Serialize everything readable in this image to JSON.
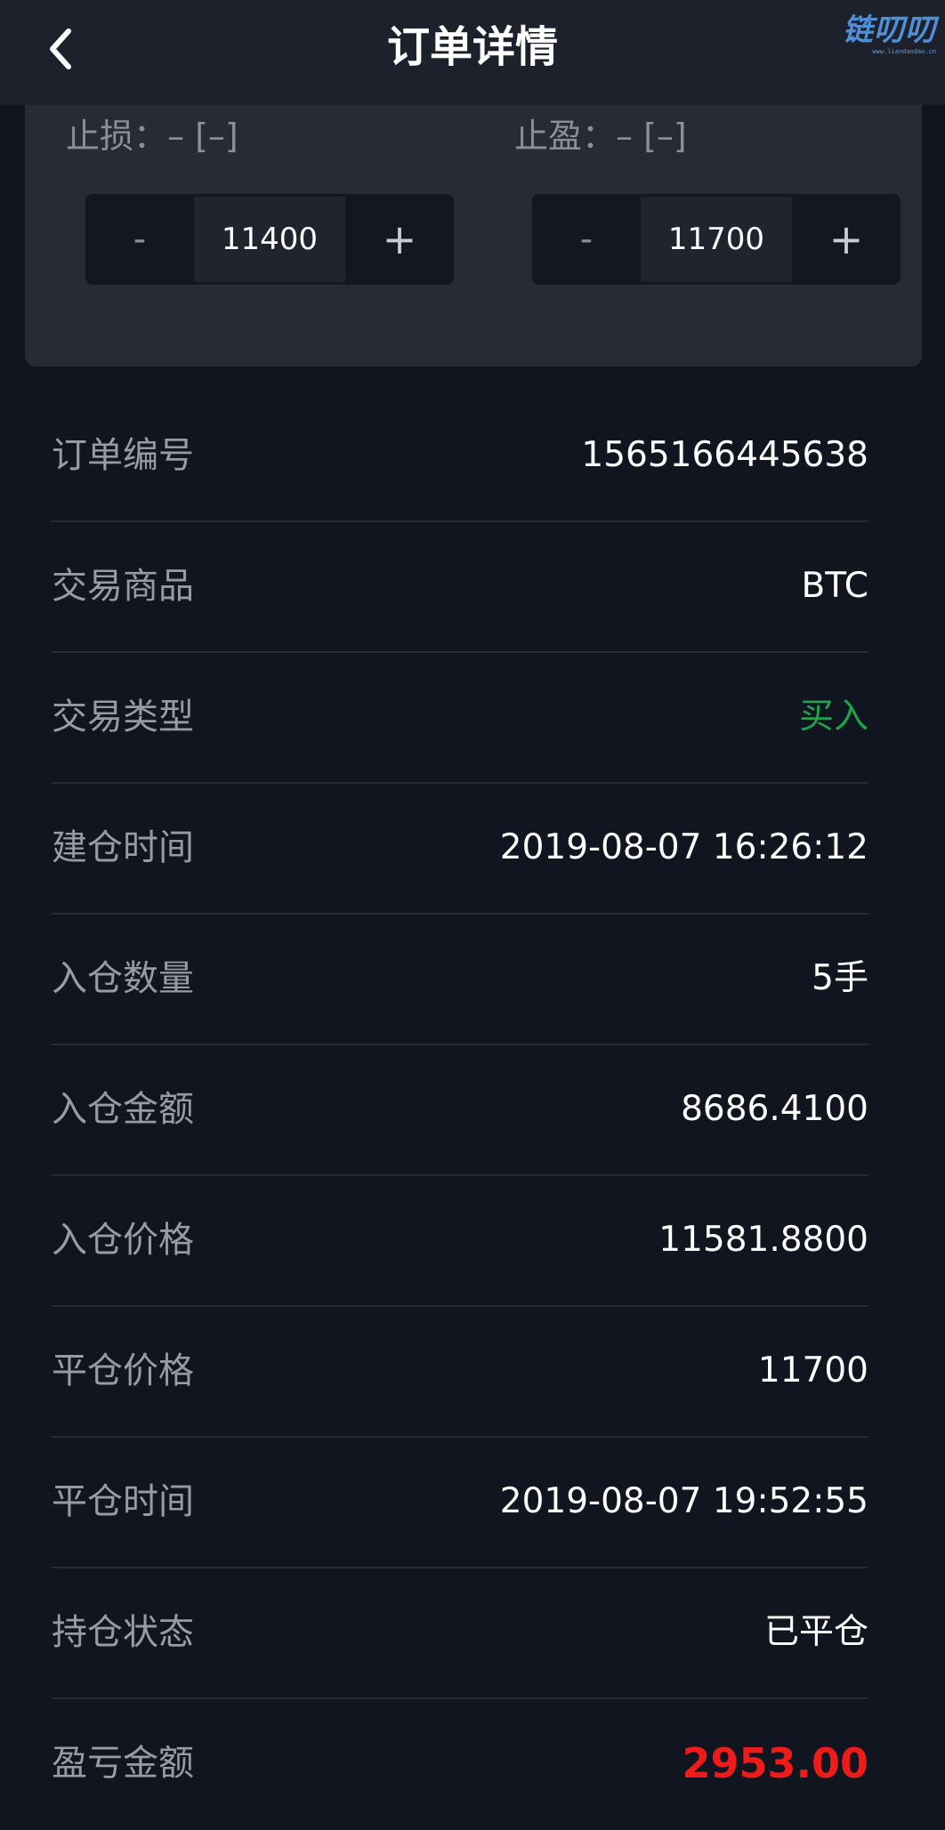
{
  "header": {
    "title": "订单详情",
    "back_icon": "chevron-left-icon",
    "watermark": "链叨叨",
    "watermark_sub": "www.liandaodao.cn"
  },
  "stop_loss": {
    "label": "止损：– [–]",
    "minus": "-",
    "value": "11400",
    "plus": "+"
  },
  "take_profit": {
    "label": "止盈：– [–]",
    "minus": "-",
    "value": "11700",
    "plus": "+"
  },
  "details": [
    {
      "label": "订单编号",
      "value": "1565166445638"
    },
    {
      "label": "交易商品",
      "value": "BTC"
    },
    {
      "label": "交易类型",
      "value": "买入"
    },
    {
      "label": "建仓时间",
      "value": "2019-08-07 16:26:12"
    },
    {
      "label": "入仓数量",
      "value": "5手"
    },
    {
      "label": "入仓金额",
      "value": "8686.4100"
    },
    {
      "label": "入仓价格",
      "value": "11581.8800"
    },
    {
      "label": "平仓价格",
      "value": "11700"
    },
    {
      "label": "平仓时间",
      "value": "2019-08-07 19:52:55"
    },
    {
      "label": "持仓状态",
      "value": "已平仓"
    },
    {
      "label": "盈亏金额",
      "value": "2953.00"
    }
  ],
  "colors": {
    "background": "#11151f",
    "buy_green": "#1fa34a",
    "profit_red": "#ee1b1b"
  }
}
